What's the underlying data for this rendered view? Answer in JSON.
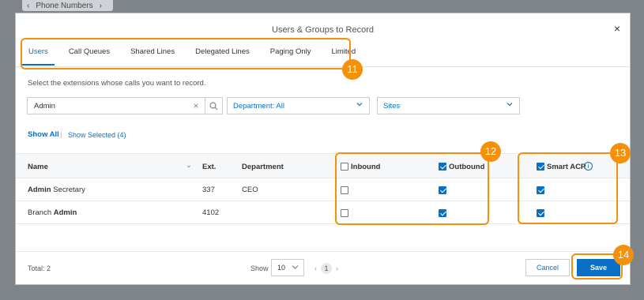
{
  "backdrop": {
    "arrow": "‹",
    "label": "Phone Numbers",
    "chevron": "›"
  },
  "dialog": {
    "title": "Users & Groups to Record",
    "close": "×",
    "tabs": [
      {
        "label": "Users",
        "active": true
      },
      {
        "label": "Call Queues"
      },
      {
        "label": "Shared Lines"
      },
      {
        "label": "Delegated Lines"
      },
      {
        "label": "Paging Only"
      },
      {
        "label": "Limited"
      }
    ],
    "instructions": "Select the extensions whose calls you want to record.",
    "search": {
      "value": "Admin",
      "clear": "×"
    },
    "department_select": "Department: All",
    "sites_select": "Sites",
    "show_all": "Show All",
    "separator": "|",
    "show_selected": "Show Selected (4)",
    "columns": {
      "name": "Name",
      "sort": "⌄",
      "ext": "Ext.",
      "department": "Department",
      "inbound": "Inbound",
      "outbound": "Outbound",
      "smart_acr": "Smart ACR",
      "info": "i"
    },
    "header_checks": {
      "inbound": false,
      "outbound": true,
      "smart_acr": true
    },
    "rows": [
      {
        "name_bold": "Admin",
        "name_rest": " Secretary",
        "ext": "337",
        "department": "CEO",
        "inbound": false,
        "outbound": true,
        "smart_acr": true
      },
      {
        "name_pre": "Branch ",
        "name_bold": "Admin",
        "ext": "4102",
        "department": "",
        "inbound": false,
        "outbound": true,
        "smart_acr": true
      }
    ],
    "footer": {
      "total": "Total: 2",
      "show": "Show",
      "page_size": "10",
      "prev": "‹",
      "page": "1",
      "next": "›",
      "cancel": "Cancel",
      "save": "Save"
    }
  },
  "markers": [
    "11",
    "12",
    "13",
    "14"
  ],
  "colors": {
    "accent": "#0a70c6",
    "callout": "#f5900a"
  }
}
